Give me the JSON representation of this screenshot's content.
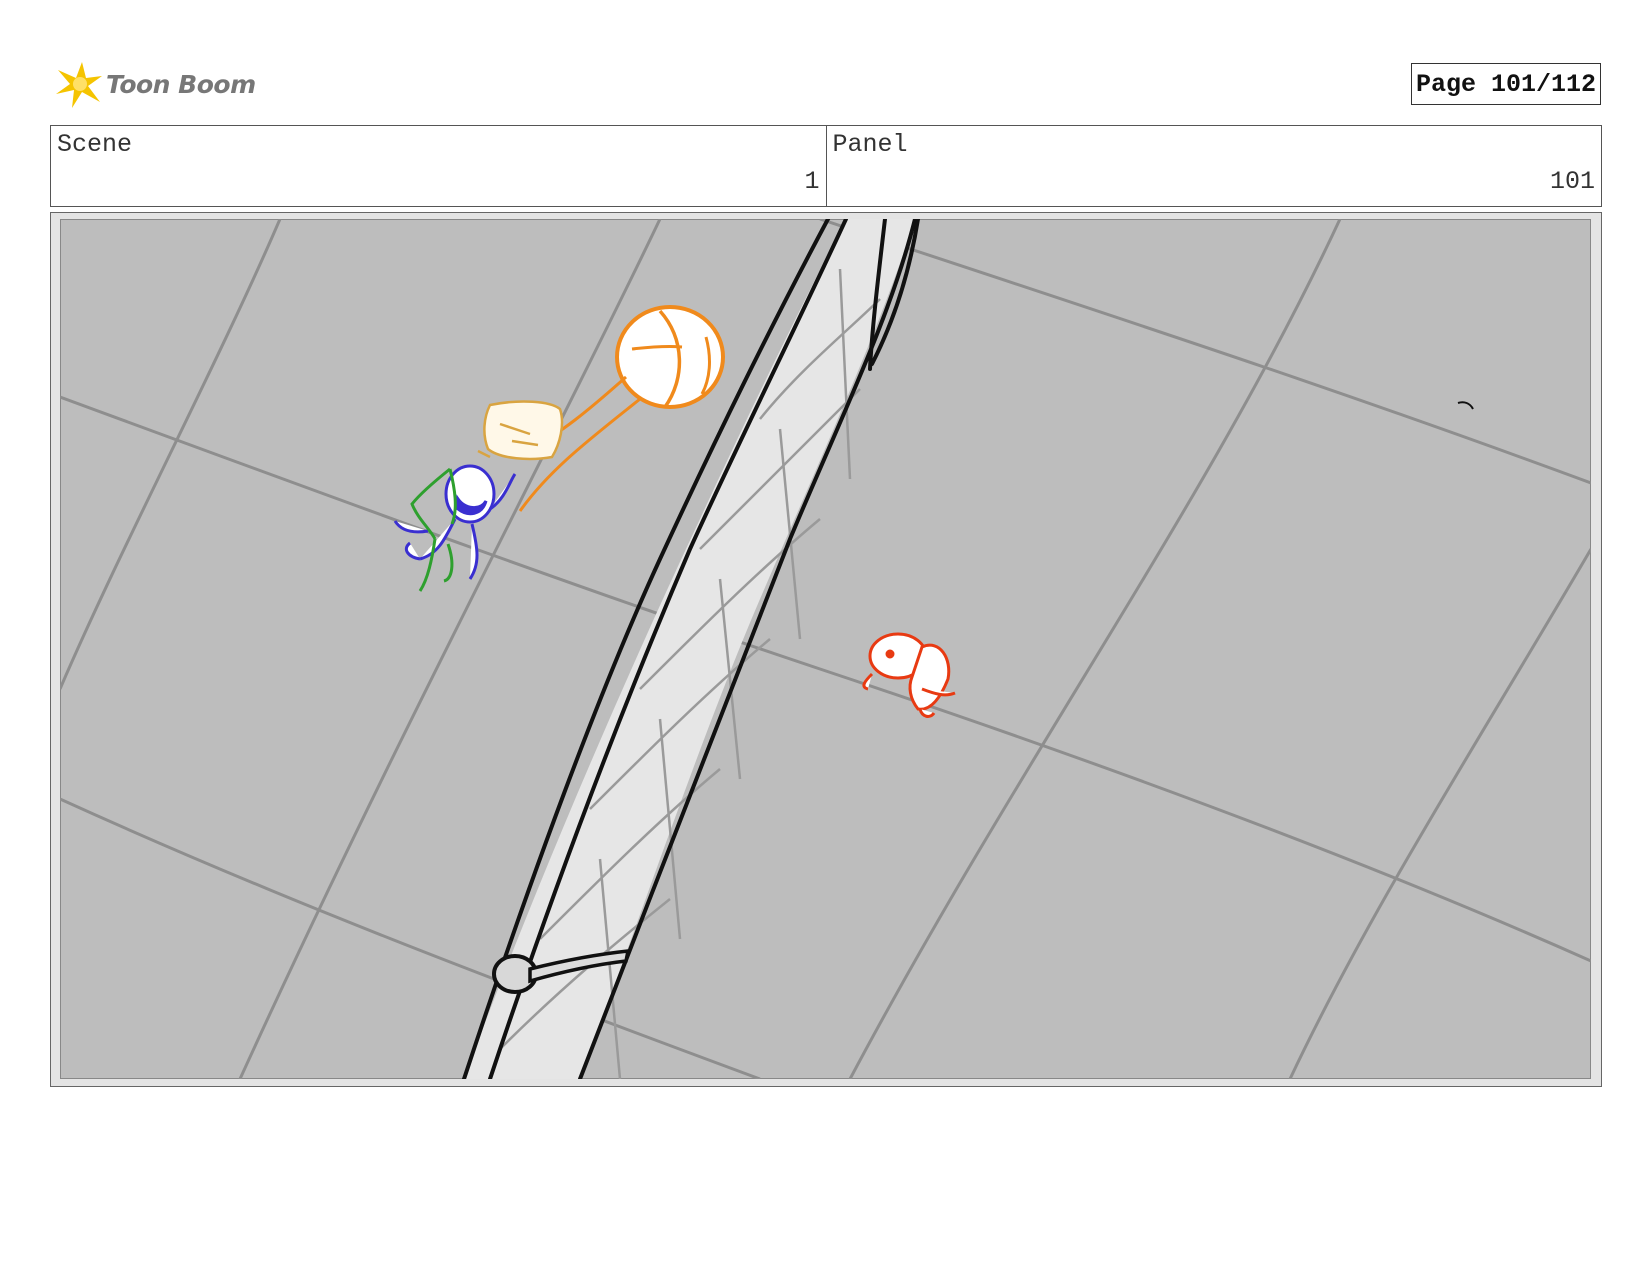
{
  "header": {
    "logo_text": "Toon Boom",
    "page_label": "Page 101/112"
  },
  "info": {
    "scene_label": "Scene",
    "scene_value": "1",
    "panel_label": "Panel",
    "panel_value": "101"
  },
  "colors": {
    "logo_yellow": "#f5c400",
    "sketch_orange": "#f08a1c",
    "sketch_tan": "#d9a441",
    "sketch_blue": "#3a2fd0",
    "sketch_green": "#2ea02e",
    "sketch_red": "#e83a12",
    "floor_gray": "#bdbdbd"
  }
}
